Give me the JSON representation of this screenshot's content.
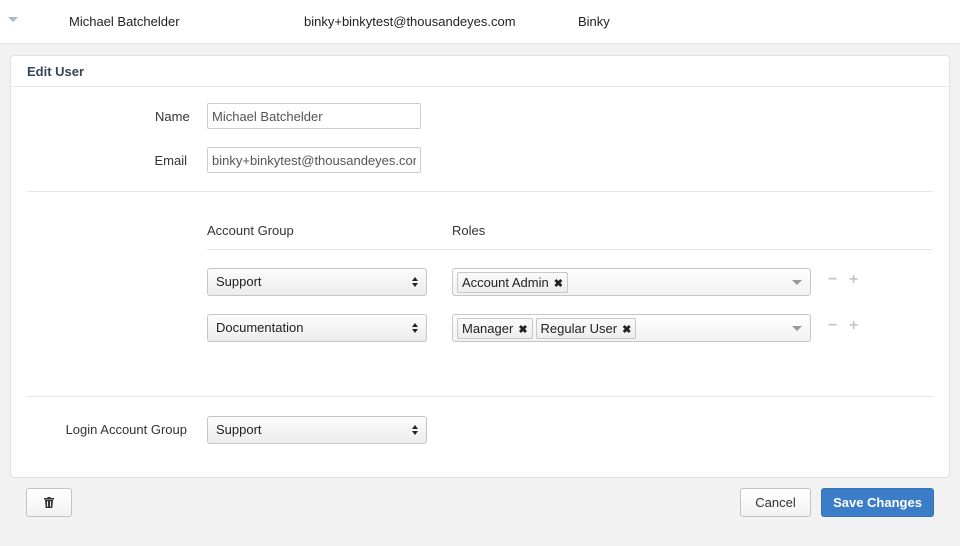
{
  "user_row": {
    "name": "Michael Batchelder",
    "email": "binky+binkytest@thousandeyes.com",
    "nickname": "Binky"
  },
  "edit_user": {
    "title": "Edit User",
    "name_label": "Name",
    "name_value": "Michael Batchelder",
    "email_label": "Email",
    "email_value": "binky+binkytest@thousandeyes.com"
  },
  "assignments": {
    "account_group_header": "Account Group",
    "roles_header": "Roles",
    "rows": [
      {
        "account_group": "Support",
        "roles": [
          "Account Admin"
        ]
      },
      {
        "account_group": "Documentation",
        "roles": [
          "Manager",
          "Regular User"
        ]
      }
    ],
    "remove_symbol": "−",
    "add_symbol": "+",
    "tag_remove_symbol": "✖"
  },
  "login": {
    "label": "Login Account Group",
    "value": "Support"
  },
  "footer": {
    "delete_icon": "trash-icon",
    "cancel_label": "Cancel",
    "save_label": "Save Changes"
  },
  "colors": {
    "primary": "#3b7dc7",
    "header_text": "#33475b"
  }
}
